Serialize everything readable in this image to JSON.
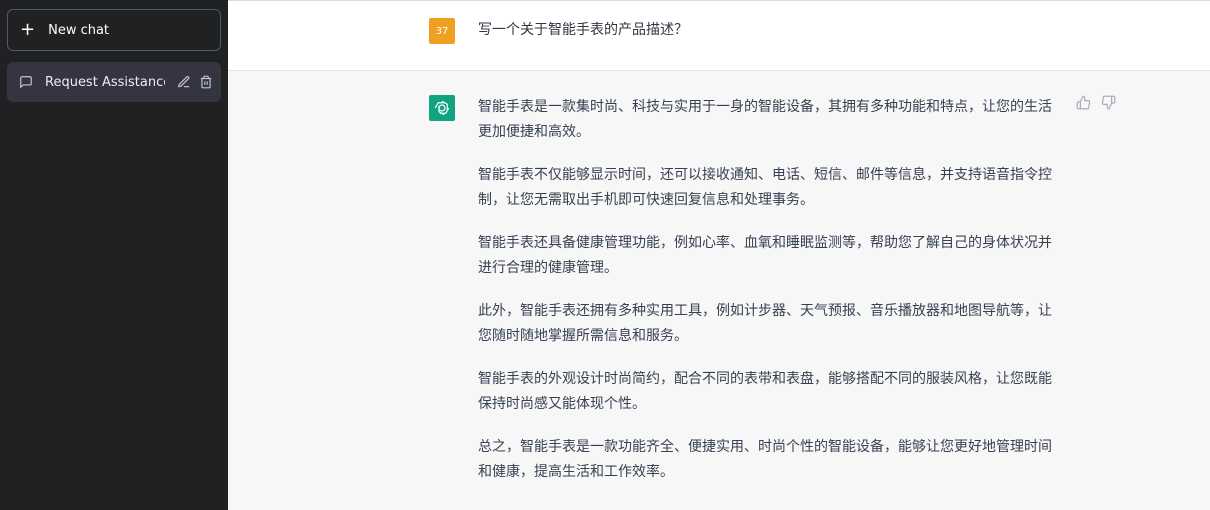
{
  "sidebar": {
    "new_chat": "New chat",
    "conversations": [
      {
        "title": "Request Assistance A"
      }
    ]
  },
  "user": {
    "avatar": "37",
    "message": "写一个关于智能手表的产品描述？"
  },
  "assistant": {
    "paragraphs": [
      "智能手表是一款集时尚、科技与实用于一身的智能设备，其拥有多种功能和特点，让您的生活更加便捷和高效。",
      "智能手表不仅能够显示时间，还可以接收通知、电话、短信、邮件等信息，并支持语音指令控制，让您无需取出手机即可快速回复信息和处理事务。",
      "智能手表还具备健康管理功能，例如心率、血氧和睡眠监测等，帮助您了解自己的身体状况并进行合理的健康管理。",
      "此外，智能手表还拥有多种实用工具，例如计步器、天气预报、音乐播放器和地图导航等，让您随时随地掌握所需信息和服务。",
      "智能手表的外观设计时尚简约，配合不同的表带和表盘，能够搭配不同的服装风格，让您既能保持时尚感又能体现个性。",
      "总之，智能手表是一款功能齐全、便捷实用、时尚个性的智能设备，能够让您更好地管理时间和健康，提高生活和工作效率。"
    ]
  },
  "colors": {
    "sidebar": "#202123",
    "gpt": "#10a37f",
    "avatar": "#f0a020"
  }
}
